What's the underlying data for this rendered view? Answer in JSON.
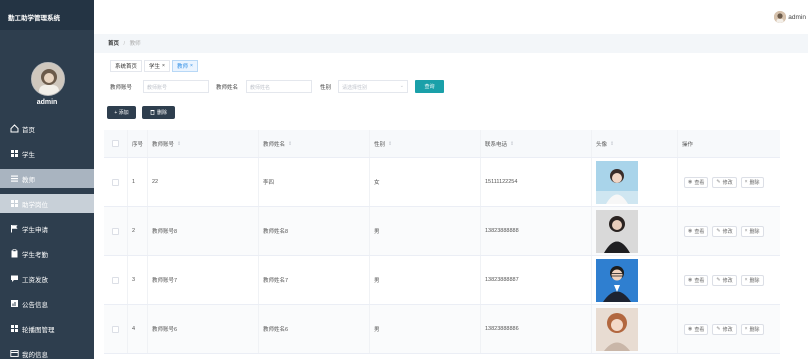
{
  "app": {
    "title": "勤工助学管理系统"
  },
  "sidebar": {
    "user_name": "admin",
    "items": [
      {
        "label": "首页",
        "icon": "home-icon"
      },
      {
        "label": "学生",
        "icon": "grid-icon"
      },
      {
        "label": "教师",
        "icon": "list-icon"
      },
      {
        "label": "助学岗位",
        "icon": "grid-icon"
      },
      {
        "label": "学生申请",
        "icon": "flag-icon"
      },
      {
        "label": "学生考勤",
        "icon": "clipboard-icon"
      },
      {
        "label": "工资发放",
        "icon": "chat-icon"
      },
      {
        "label": "公告信息",
        "icon": "chart-icon"
      },
      {
        "label": "轮播图管理",
        "icon": "grid-icon"
      },
      {
        "label": "我的信息",
        "icon": "card-icon"
      }
    ]
  },
  "topbar": {
    "user": "admin"
  },
  "breadcrumb": {
    "home": "首页",
    "sep": "/",
    "current": "教师"
  },
  "tabs": [
    {
      "label": "系统首页",
      "closable": false
    },
    {
      "label": "学生",
      "closable": true
    },
    {
      "label": "教师",
      "closable": true
    }
  ],
  "tab_close": "×",
  "search": {
    "field1_label": "教师账号",
    "field1_placeholder": "教师账号",
    "field2_label": "教师姓名",
    "field2_placeholder": "教师姓名",
    "field3_label": "性别",
    "field3_placeholder": "请选择性别",
    "button": "查询"
  },
  "actions": {
    "add": "+ 添加",
    "delete": "删除"
  },
  "table": {
    "headers": {
      "index": "序号",
      "account": "教师账号",
      "name": "教师姓名",
      "gender": "性别",
      "phone": "联系电话",
      "avatar": "头像",
      "ops": "操作"
    },
    "sort_mark": "⇕",
    "row_ops": {
      "view": "查看",
      "edit": "修改",
      "del": "删除"
    },
    "rows": [
      {
        "index": "1",
        "account": "22",
        "name": "李四",
        "gender": "女",
        "phone": "15111122254"
      },
      {
        "index": "2",
        "account": "教师账号8",
        "name": "教师姓名8",
        "gender": "男",
        "phone": "13823888888"
      },
      {
        "index": "3",
        "account": "教师账号7",
        "name": "教师姓名7",
        "gender": "男",
        "phone": "13823888887"
      },
      {
        "index": "4",
        "account": "教师账号6",
        "name": "教师姓名6",
        "gender": "男",
        "phone": "13823888886"
      }
    ]
  },
  "colors": {
    "sidebar": "#2e3e4e",
    "accent": "#1aa0a9",
    "active_tab": "#2f8ee5"
  }
}
